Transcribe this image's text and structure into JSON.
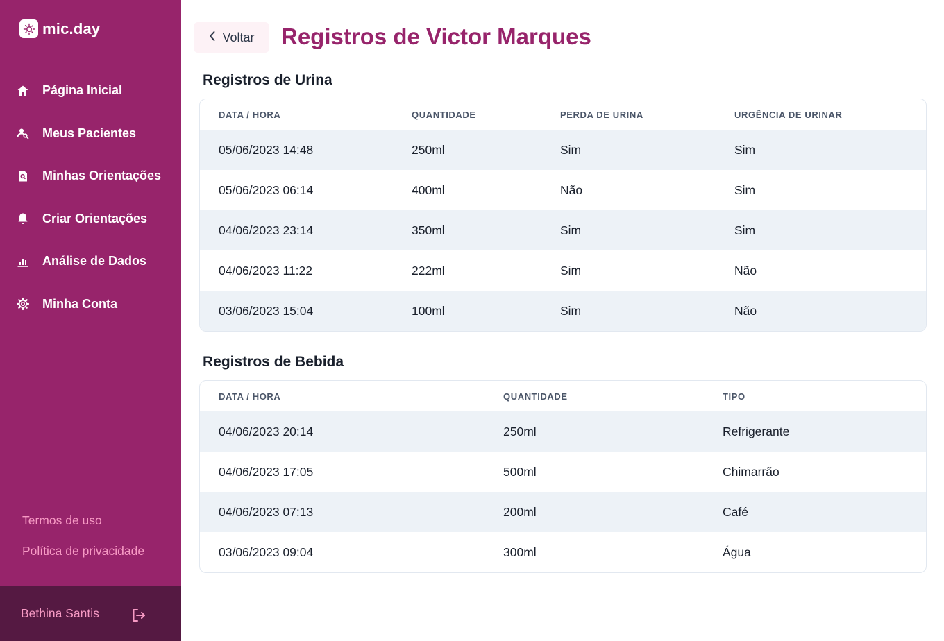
{
  "brand": {
    "name": "mic.day"
  },
  "sidebar": {
    "items": [
      {
        "label": "Página Inicial",
        "icon": "home-icon"
      },
      {
        "label": "Meus Pacientes",
        "icon": "user-search-icon"
      },
      {
        "label": "Minhas Orientações",
        "icon": "document-search-icon"
      },
      {
        "label": "Criar Orientações",
        "icon": "bell-icon"
      },
      {
        "label": "Análise de Dados",
        "icon": "bar-chart-icon"
      },
      {
        "label": "Minha Conta",
        "icon": "gear-icon"
      }
    ],
    "footer_links": [
      "Termos de uso",
      "Política de privacidade"
    ],
    "user_name": "Bethina Santis"
  },
  "header": {
    "back_label": "Voltar",
    "title": "Registros de Victor Marques"
  },
  "urine": {
    "title": "Registros de Urina",
    "headers": [
      "DATA / HORA",
      "QUANTIDADE",
      "PERDA DE URINA",
      "URGÊNCIA DE URINAR"
    ],
    "rows": [
      [
        "05/06/2023 14:48",
        "250ml",
        "Sim",
        "Sim"
      ],
      [
        "05/06/2023 06:14",
        "400ml",
        "Não",
        "Sim"
      ],
      [
        "04/06/2023 23:14",
        "350ml",
        "Sim",
        "Sim"
      ],
      [
        "04/06/2023 11:22",
        "222ml",
        "Sim",
        "Não"
      ],
      [
        "03/06/2023 15:04",
        "100ml",
        "Sim",
        "Não"
      ]
    ]
  },
  "drink": {
    "title": "Registros de Bebida",
    "headers": [
      "DATA / HORA",
      "QUANTIDADE",
      "TIPO"
    ],
    "rows": [
      [
        "04/06/2023 20:14",
        "250ml",
        "Refrigerante"
      ],
      [
        "04/06/2023 17:05",
        "500ml",
        "Chimarrão"
      ],
      [
        "04/06/2023 07:13",
        "200ml",
        "Café"
      ],
      [
        "03/06/2023 09:04",
        "300ml",
        "Água"
      ]
    ]
  },
  "colors": {
    "sidebar": "#97246b",
    "sidebar_footer": "#551942",
    "accent_pink": "#f79ac4",
    "title": "#97246b",
    "row_stripe": "#edf2f7"
  }
}
